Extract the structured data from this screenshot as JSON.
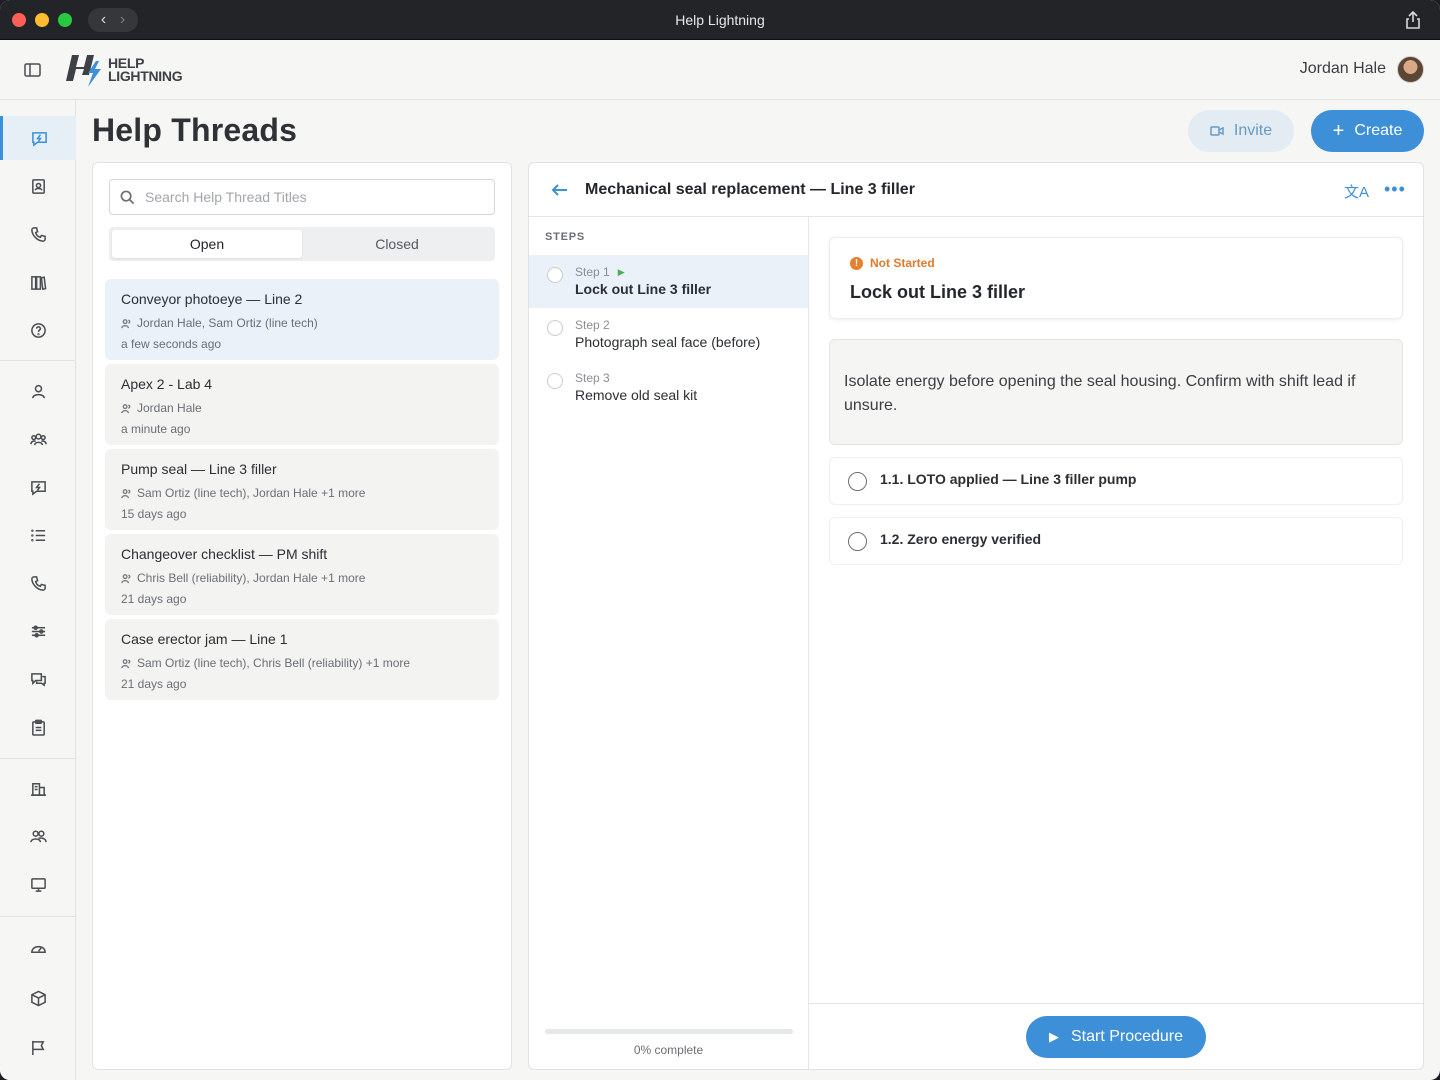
{
  "window": {
    "title": "Help Lightning"
  },
  "header": {
    "logo_line1": "HELP",
    "logo_line2": "LIGHTNING",
    "user_name": "Jordan Hale"
  },
  "nav": {
    "icons": [
      "help-thread-icon",
      "contacts-icon",
      "phone-icon",
      "library-icon",
      "help-icon",
      "user-icon",
      "team-icon",
      "help-thread-admin-icon",
      "list-icon",
      "calls-icon",
      "settings-sliders-icon",
      "messages-icon",
      "clipboard-icon",
      "building-icon",
      "groups-icon",
      "monitor-icon",
      "dashboard-icon",
      "package-icon",
      "flag-icon"
    ]
  },
  "page": {
    "title": "Help Threads",
    "invite_label": "Invite",
    "create_label": "Create"
  },
  "threads": {
    "search_placeholder": "Search Help Thread Titles",
    "tab_open": "Open",
    "tab_closed": "Closed",
    "items": [
      {
        "title": "Conveyor photoeye — Line 2",
        "participants": "Jordan Hale, Sam Ortiz (line tech)",
        "time": "a few seconds ago"
      },
      {
        "title": "Apex 2 - Lab 4",
        "participants": "Jordan Hale",
        "time": "a minute ago"
      },
      {
        "title": "Pump seal — Line 3 filler",
        "participants": "Sam Ortiz (line tech), Jordan Hale +1 more",
        "time": "15 days ago"
      },
      {
        "title": "Changeover checklist — PM shift",
        "participants": "Chris Bell (reliability), Jordan Hale +1 more",
        "time": "21 days ago"
      },
      {
        "title": "Case erector jam — Line 1",
        "participants": "Sam Ortiz (line tech), Chris Bell (reliability) +1 more",
        "time": "21 days ago"
      }
    ]
  },
  "detail": {
    "title": "Mechanical seal replacement — Line 3 filler",
    "steps_label": "STEPS",
    "steps": [
      {
        "num": "Step 1",
        "title": "Lock out Line 3 filler"
      },
      {
        "num": "Step 2",
        "title": "Photograph seal face (before)"
      },
      {
        "num": "Step 3",
        "title": "Remove old seal kit"
      }
    ],
    "progress": 0,
    "progress_text": "0% complete",
    "status": "Not Started",
    "step_title": "Lock out Line 3 filler",
    "note": "Isolate energy before opening the seal housing. Confirm with shift lead if unsure.",
    "checks": [
      "1.1. LOTO applied — Line 3 filler pump",
      "1.2. Zero energy verified"
    ],
    "start_label": "Start Procedure"
  },
  "colors": {
    "accent": "#3d8fd8",
    "status": "#e07a2c",
    "active_bg": "#eaf1f8"
  }
}
